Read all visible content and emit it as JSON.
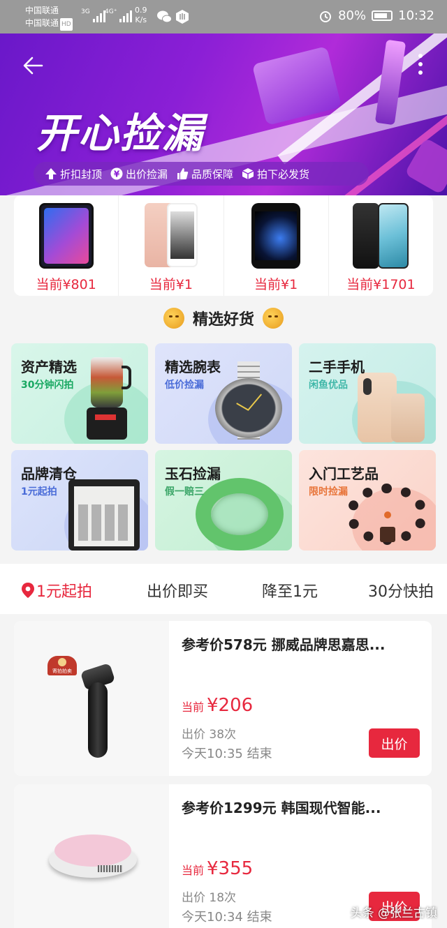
{
  "status_bar": {
    "carrier1": "中国联通",
    "carrier2": "中国联通",
    "hd": "HD",
    "sig1_label": "3G",
    "sig2_label": "4G⁺",
    "net_speed": "0.9",
    "net_unit": "K/s",
    "battery": "80%",
    "time": "10:32"
  },
  "banner": {
    "title": "开心捡漏",
    "tags": [
      "折扣封顶",
      "出价捡漏",
      "品质保障",
      "拍下必发货"
    ]
  },
  "featured_prices": [
    {
      "label": "当前",
      "price": "¥801"
    },
    {
      "label": "当前",
      "price": "¥1"
    },
    {
      "label": "当前",
      "price": "¥1"
    },
    {
      "label": "当前",
      "price": "¥1701"
    }
  ],
  "section_title": "精选好货",
  "categories": [
    {
      "title": "资产精选",
      "subtitle": "30分钟闪拍",
      "sub_color": "#19a862"
    },
    {
      "title": "精选腕表",
      "subtitle": "低价捡漏",
      "sub_color": "#4a6cd8"
    },
    {
      "title": "二手手机",
      "subtitle": "闲鱼优品",
      "sub_color": "#3fb7a8"
    },
    {
      "title": "品牌清仓",
      "subtitle": "1元起拍",
      "sub_color": "#4a6cd8"
    },
    {
      "title": "玉石捡漏",
      "subtitle": "假一赔三",
      "sub_color": "#3aa567"
    },
    {
      "title": "入门工艺品",
      "subtitle": "限时捡漏",
      "sub_color": "#e8753a"
    }
  ],
  "tabs": [
    "1元起拍",
    "出价即买",
    "降至1元",
    "30分快拍"
  ],
  "listings": [
    {
      "name": "参考价578元 挪威品牌思嘉思...",
      "cur_label": "当前",
      "price": "¥206",
      "bids": "出价 38次",
      "end": "今天10:35 结束",
      "button": "出价",
      "badge": "寄拍拍卖"
    },
    {
      "name": "参考价1299元 韩国现代智能...",
      "cur_label": "当前",
      "price": "¥355",
      "bids": "出价 18次",
      "end": "今天10:34 结束",
      "button": "出价"
    }
  ],
  "watermark": "头条 @张兰古镇",
  "colors": {
    "accent": "#e7283e",
    "banner": "#8b1fd6"
  }
}
